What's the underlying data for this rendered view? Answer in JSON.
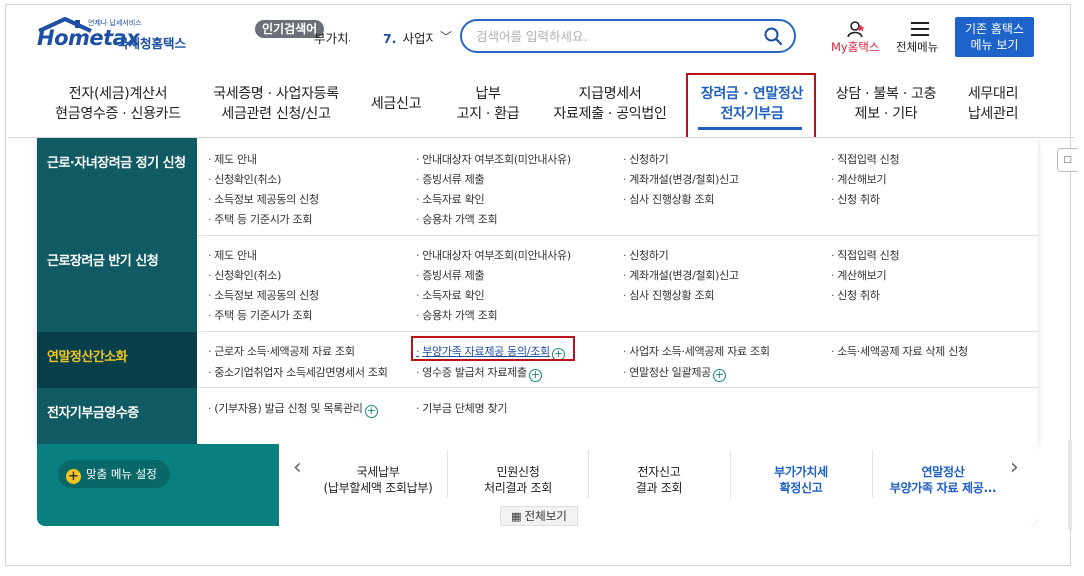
{
  "header": {
    "logo_main": "Hometax",
    "logo_sub": "언제나 납세서비스",
    "logo_kr": "국세청홈택스",
    "popular_badge": "인기검색어",
    "popular_text": "부가치세",
    "popular_rank": "7.",
    "popular_rank_text": "사업자",
    "search_placeholder": "검색어를 입력하세요.",
    "my_label": "My홈택스",
    "menu_label": "전체메뉴",
    "old_home_line1": "기존 홈택스",
    "old_home_line2": "메뉴 보기"
  },
  "nav": [
    {
      "l1": "전자(세금)계산서",
      "l2": "현금영수증 · 신용카드"
    },
    {
      "l1": "국세증명 · 사업자등록",
      "l2": "세금관련 신청/신고"
    },
    {
      "l1": "세금신고",
      "l2": ""
    },
    {
      "l1": "납부",
      "l2": "고지 · 환급"
    },
    {
      "l1": "지급명세서",
      "l2": "자료제출 · 공익법인"
    },
    {
      "l1": "장려금 · 연말정산",
      "l2": "전자기부금"
    },
    {
      "l1": "상담 · 불복 · 고충",
      "l2": "제보 · 기타"
    },
    {
      "l1": "세무대리",
      "l2": "납세관리"
    }
  ],
  "mega": {
    "categories": [
      "근로·자녀장려금 정기 신청",
      "근로장려금 반기 신청",
      "연말정산간소화",
      "전자기부금영수증"
    ],
    "row1": [
      "제도 안내",
      "안내대상자 여부조회(미안내사유)",
      "신청하기",
      "직접입력 신청",
      "신청확인(취소)",
      "증빙서류 제출",
      "계좌개설(변경/철회)신고",
      "계산해보기",
      "소득정보 제공동의 신청",
      "소득자료 확인",
      "심사 진행상황 조회",
      "신청 취하",
      "주택 등 기준시가 조회",
      "승용차 가액 조회"
    ],
    "row2": [
      "제도 안내",
      "안내대상자 여부조회(미안내사유)",
      "신청하기",
      "직접입력 신청",
      "신청확인(취소)",
      "증빙서류 제출",
      "계좌개설(변경/철회)신고",
      "계산해보기",
      "소득정보 제공동의 신청",
      "소득자료 확인",
      "심사 진행상황 조회",
      "신청 취하",
      "주택 등 기준시가 조회",
      "승용차 가액 조회"
    ],
    "row3": [
      "근로자 소득·세액공제 자료 조회",
      "부양가족 자료제공 동의/조회",
      "사업자 소득·세액공제 자료 조회",
      "소득·세액공제 자료 삭제 신청",
      "중소기업취업자 소득세감면명세서 조회",
      "영수증 발급처 자료제출",
      "연말정산 일괄제공"
    ],
    "row4": [
      "(기부자용) 발급 신청 및 목록관리",
      "기부금 단체명 찾기"
    ]
  },
  "bottom": {
    "fav_label": "맞춤 메뉴 설정",
    "quick": [
      {
        "l1": "국세납부",
        "l2": "(납부할세액 조회납부)"
      },
      {
        "l1": "민원신청",
        "l2": "처리결과 조회"
      },
      {
        "l1": "전자신고",
        "l2": "결과 조회"
      },
      {
        "l1": "부가가치세",
        "l2": "확정신고"
      },
      {
        "l1": "연말정산",
        "l2": "부양가족 자료 제공..."
      }
    ],
    "view_all": "전체보기"
  },
  "side_tab": "□"
}
